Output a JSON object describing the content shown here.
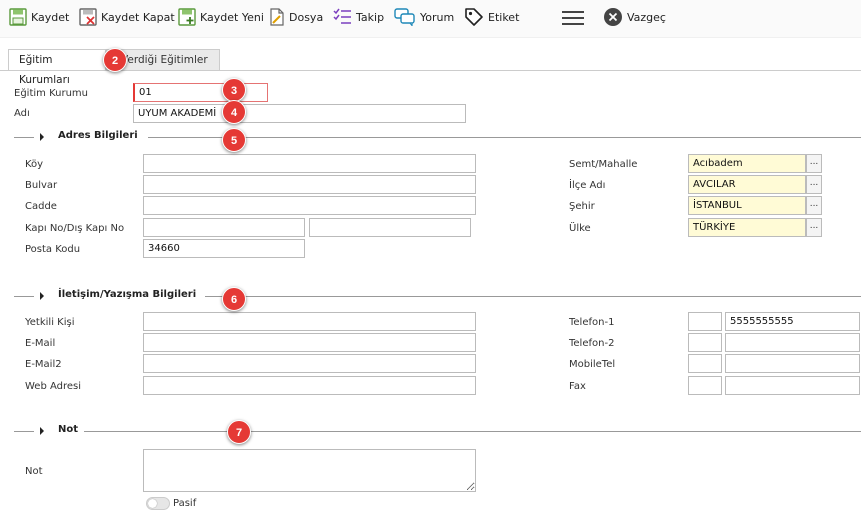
{
  "toolbar": {
    "save": "Kaydet",
    "save_close": "Kaydet Kapat",
    "save_new": "Kaydet Yeni",
    "file": "Dosya",
    "follow": "Takip",
    "comment": "Yorum",
    "tag": "Etiket",
    "cancel": "Vazgeç"
  },
  "tabs": [
    {
      "label": "Eğitim Kurumları"
    },
    {
      "label": "Verdiği Eğitimler"
    }
  ],
  "badges": [
    "2",
    "3",
    "4",
    "5",
    "6",
    "7"
  ],
  "header_fields": {
    "code_label": "Eğitim Kurumu",
    "code_value": "01",
    "name_label": "Adı",
    "name_value": "UYUM AKADEMİ"
  },
  "address": {
    "title": "Adres Bilgileri",
    "village_label": "Köy",
    "village_value": "",
    "boulevard_label": "Bulvar",
    "boulevard_value": "",
    "street_label": "Cadde",
    "street_value": "",
    "door_label": "Kapı No/Dış Kapı No",
    "door_value": "",
    "outer_door_value": "",
    "postal_label": "Posta Kodu",
    "postal_value": "34660",
    "district_label": "Semt/Mahalle",
    "district_value": "Acıbadem",
    "county_label": "İlçe Adı",
    "county_value": "AVCILAR",
    "city_label": "Şehir",
    "city_value": "İSTANBUL",
    "country_label": "Ülke",
    "country_value": "TÜRKİYE",
    "lookup": "..."
  },
  "contact": {
    "title": "İletişim/Yazışma Bilgileri",
    "person_label": "Yetkili Kişi",
    "email_label": "E-Mail",
    "email2_label": "E-Mail2",
    "web_label": "Web Adresi",
    "phone1_label": "Telefon-1",
    "phone1_value": "5555555555",
    "phone2_label": "Telefon-2",
    "mobile_label": "MobileTel",
    "fax_label": "Fax"
  },
  "note": {
    "title": "Not",
    "label": "Not",
    "value": "",
    "passive_label": "Pasif"
  },
  "colors": {
    "badge": "#e53935",
    "lookup_bg": "#fffbd6"
  }
}
